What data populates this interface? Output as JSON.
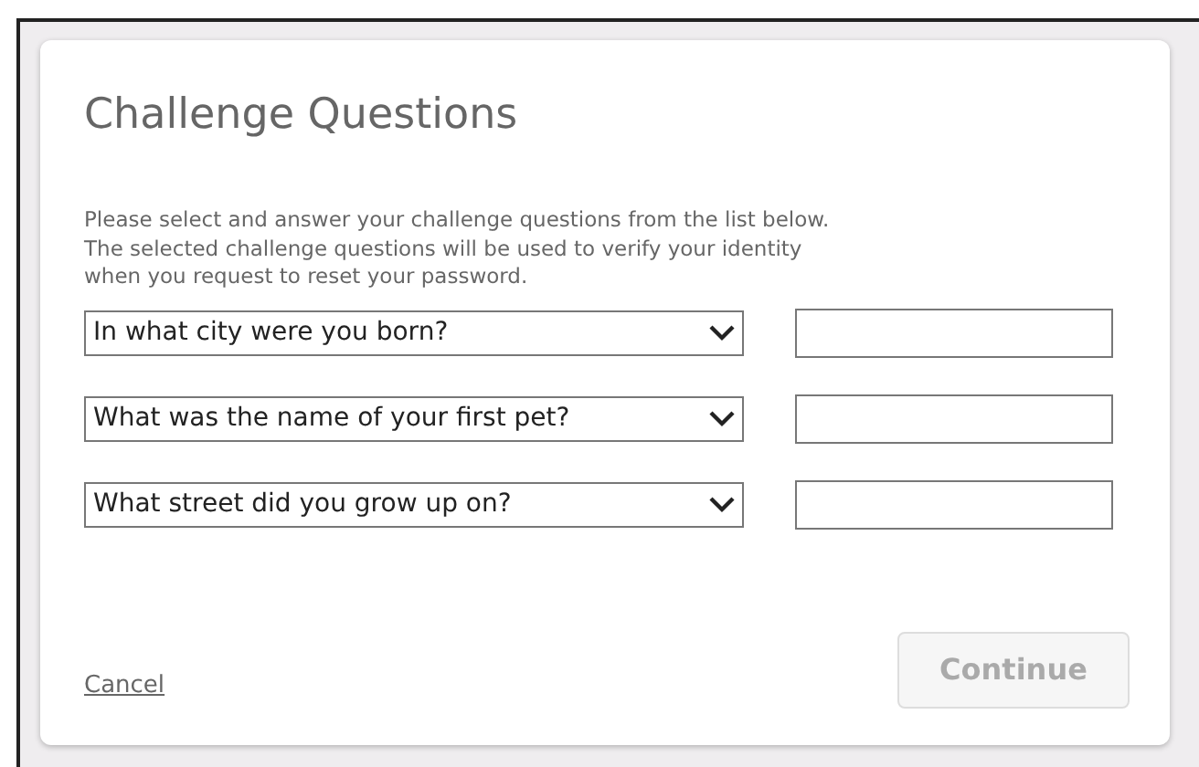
{
  "dialog": {
    "title": "Challenge Questions",
    "description": "Please select and answer your challenge questions from the list below.\nThe selected challenge questions will be used to verify your identity\nwhen you request to reset your password.",
    "questions": [
      {
        "question": "In what city were you born?"
      },
      {
        "question": "What was the name of your first pet?"
      },
      {
        "question": "What street did you grow up on?"
      }
    ],
    "cancel": "Cancel",
    "continue": {
      "label": "Continue",
      "disabled": true
    }
  }
}
